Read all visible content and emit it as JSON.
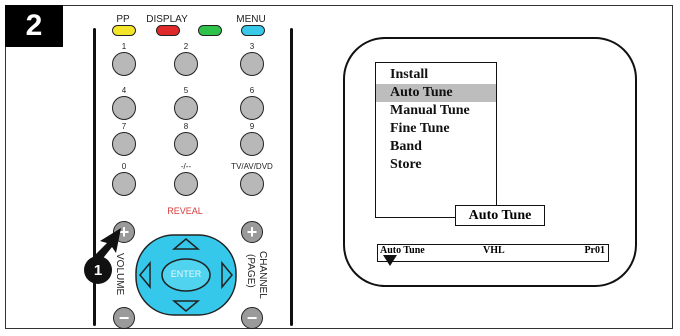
{
  "step_number": "2",
  "callout_number": "1",
  "remote": {
    "top_labels": {
      "pp": "PP",
      "display": "DISPLAY",
      "menu": "MENU"
    },
    "color_keys": {
      "yellow": "#f5e52a",
      "red": "#e02a2a",
      "green": "#2fc24a",
      "cyan": "#38c8e8"
    },
    "num_keys": [
      "1",
      "2",
      "3",
      "4",
      "5",
      "6",
      "7",
      "8",
      "9",
      "0",
      "-/--",
      "TV/AV/DVD"
    ],
    "reveal": "REVEAL",
    "enter": "ENTER",
    "volume": "VOLUME",
    "channel": "CHANNEL",
    "page": "(PAGE)",
    "plus": "+",
    "minus": "−",
    "nav_color": "#35c8ea",
    "enter_color": "#4fd3ef"
  },
  "tv": {
    "menu_title": "Install",
    "menu_items": [
      "Auto Tune",
      "Manual Tune",
      "Fine Tune",
      "Band",
      "Store"
    ],
    "selected_index": 0,
    "osd_box": "Auto Tune",
    "status": {
      "mode": "Auto Tune",
      "band": "VHL",
      "program": "Pr01"
    }
  }
}
